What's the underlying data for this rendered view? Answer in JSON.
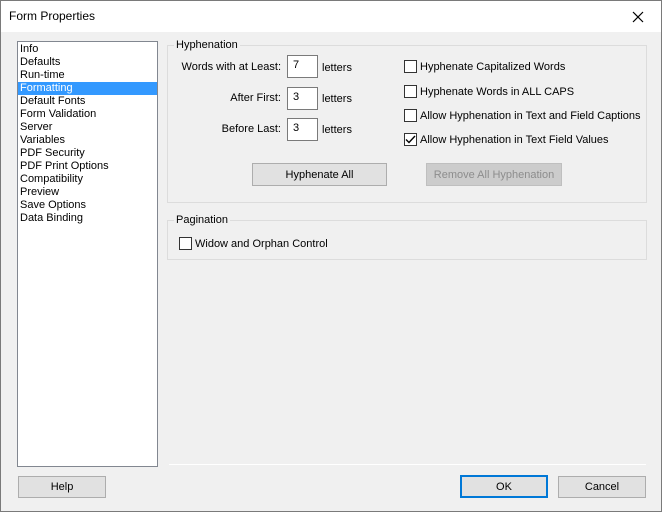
{
  "window": {
    "title": "Form Properties"
  },
  "nav": {
    "items": [
      {
        "label": "Info"
      },
      {
        "label": "Defaults"
      },
      {
        "label": "Run-time"
      },
      {
        "label": "Formatting",
        "selected": true
      },
      {
        "label": "Default Fonts"
      },
      {
        "label": "Form Validation"
      },
      {
        "label": "Server"
      },
      {
        "label": "Variables"
      },
      {
        "label": "PDF Security"
      },
      {
        "label": "PDF Print Options"
      },
      {
        "label": "Compatibility"
      },
      {
        "label": "Preview"
      },
      {
        "label": "Save Options"
      },
      {
        "label": "Data Binding"
      }
    ]
  },
  "hyphenation": {
    "group_label": "Hyphenation",
    "words_label": "Words with at Least:",
    "words_value": "7",
    "after_label": "After First:",
    "after_value": "3",
    "before_label": "Before Last:",
    "before_value": "3",
    "unit": "letters",
    "checkboxes": [
      {
        "label": "Hyphenate Capitalized Words",
        "checked": false
      },
      {
        "label": "Hyphenate Words in ALL CAPS",
        "checked": false
      },
      {
        "label": "Allow Hyphenation in Text and Field Captions",
        "checked": false
      },
      {
        "label": "Allow Hyphenation in Text Field Values",
        "checked": true
      }
    ],
    "hyphenate_all_label": "Hyphenate All",
    "remove_all_label": "Remove All Hyphenation"
  },
  "pagination": {
    "group_label": "Pagination",
    "widow_label": "Widow and Orphan Control",
    "widow_checked": false
  },
  "footer": {
    "help_label": "Help",
    "ok_label": "OK",
    "cancel_label": "Cancel"
  },
  "colors": {
    "selection": "#3399ff",
    "default_button_border": "#0078d7"
  }
}
